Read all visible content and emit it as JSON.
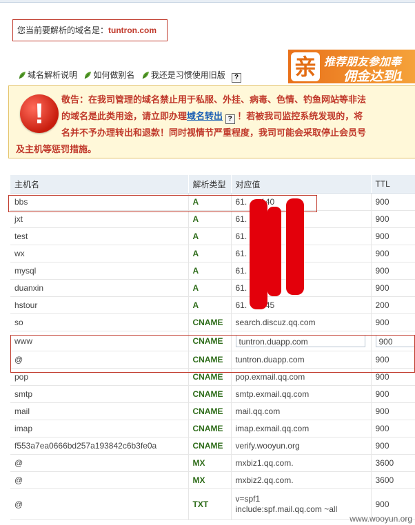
{
  "domain_notice": {
    "prefix": "您当前要解析的域名是：",
    "domain": "tuntron.com"
  },
  "links": [
    {
      "label": "域名解析说明",
      "icon": "leaf-icon"
    },
    {
      "label": "如何做别名",
      "icon": "leaf-icon"
    },
    {
      "label": "我还是习惯使用旧版",
      "icon": "leaf-icon"
    }
  ],
  "banner": {
    "big_char": "亲",
    "line1": "推荐朋友参加奉",
    "line2": "佣金达到1"
  },
  "warning": {
    "line1": "敬告：在我司管理的域名禁止用于私服、外挂、病毒、色情、钓鱼网站等非法",
    "line2a": "的域名是此类用途，请立即办理",
    "line2_link": "域名转出",
    "line2b": "！若被我司监控系统发现的，将",
    "line3": "名并不予办理转出和退款！同时视情节严重程度，我司可能会采取停止会员号",
    "line4": "及主机等惩罚措施。"
  },
  "table": {
    "headers": [
      "主机名",
      "解析类型",
      "对应值",
      "TTL"
    ],
    "rows": [
      {
        "host": "bbs",
        "type": "A",
        "value": "61.      140",
        "ttl": "900"
      },
      {
        "host": "jxt",
        "type": "A",
        "value": "61.    .145",
        "ttl": "900"
      },
      {
        "host": "test",
        "type": "A",
        "value": "61.     .145",
        "ttl": "900"
      },
      {
        "host": "wx",
        "type": "A",
        "value": "61.     .145",
        "ttl": "900"
      },
      {
        "host": "mysql",
        "type": "A",
        "value": "61.     .145",
        "ttl": "900"
      },
      {
        "host": "duanxin",
        "type": "A",
        "value": "61.     .145",
        "ttl": "900"
      },
      {
        "host": "hstour",
        "type": "A",
        "value": "61.     .145",
        "ttl": "200"
      },
      {
        "host": "so",
        "type": "CNAME",
        "value": "search.discuz.qq.com",
        "ttl": "900"
      },
      {
        "host": "www",
        "type": "CNAME",
        "value": "tuntron.duapp.com",
        "ttl": "900",
        "editing": true
      },
      {
        "host": "@",
        "type": "CNAME",
        "value": "tuntron.duapp.com",
        "ttl": "900"
      },
      {
        "host": "pop",
        "type": "CNAME",
        "value": "pop.exmail.qq.com",
        "ttl": "900"
      },
      {
        "host": "smtp",
        "type": "CNAME",
        "value": "smtp.exmail.qq.com",
        "ttl": "900"
      },
      {
        "host": "mail",
        "type": "CNAME",
        "value": "mail.qq.com",
        "ttl": "900"
      },
      {
        "host": "imap",
        "type": "CNAME",
        "value": "imap.exmail.qq.com",
        "ttl": "900"
      },
      {
        "host": "f553a7ea0666bd257a193842c6b3fe0a",
        "type": "CNAME",
        "value": "verify.wooyun.org",
        "ttl": "900"
      },
      {
        "host": "@",
        "type": "MX",
        "value": "mxbiz1.qq.com.",
        "ttl": "3600"
      },
      {
        "host": "@",
        "type": "MX",
        "value": "mxbiz2.qq.com.",
        "ttl": "3600"
      },
      {
        "host": "@",
        "type": "TXT",
        "value": "v=spf1",
        "value2": "include:spf.mail.qq.com ~all",
        "ttl": "900"
      }
    ]
  },
  "watermark": "www.wooyun.org",
  "colors": {
    "accent_red": "#c0392b",
    "type_green": "#2f6d1b",
    "redaction": "#e3000b"
  }
}
